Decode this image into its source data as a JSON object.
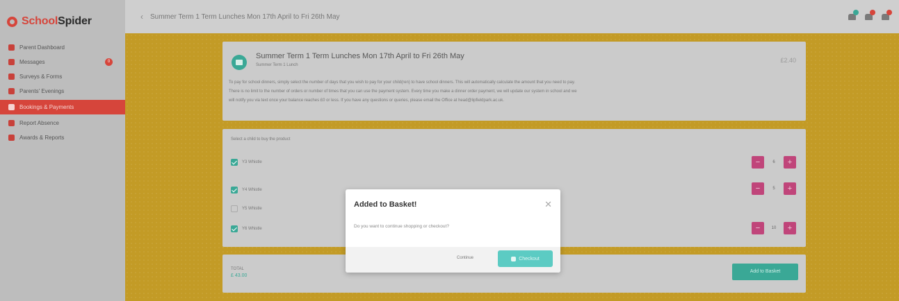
{
  "brand": {
    "logo_text_a": "School",
    "logo_text_b": "Spider"
  },
  "sidebar": {
    "items": [
      {
        "label": "Parent Dashboard",
        "icon": "home-icon"
      },
      {
        "label": "Messages",
        "icon": "mail-icon",
        "badge": "0"
      },
      {
        "label": "Surveys & Forms",
        "icon": "clipboard-icon"
      },
      {
        "label": "Parents' Evenings",
        "icon": "calendar-icon"
      },
      {
        "label": "Bookings & Payments",
        "icon": "basket-icon",
        "active": true
      },
      {
        "label": "Report Absence",
        "icon": "report-icon"
      },
      {
        "label": "Awards & Reports",
        "icon": "trophy-icon"
      }
    ]
  },
  "topbar": {
    "breadcrumb": "Summer Term 1 Term Lunches Mon 17th April to Fri 26th May"
  },
  "colors": {
    "accent_red": "#d6453b",
    "teal": "#3aa896",
    "magenta": "#c0457a",
    "background_yellow": "#c39b26"
  },
  "product": {
    "title": "Summer Term 1 Term Lunches Mon 17th April to Fri 26th May",
    "subtitle": "Summer Term 1 Lunch",
    "price": "£2.40",
    "description_lines": [
      "To pay for school dinners, simply select the number of days that you wish to pay for your child(ren) to have school dinners. This will automatically calculate the amount that you need to pay.",
      "There is no limit to the number of orders or number of times that you can use the payment system. Every time you make a dinner order payment, we will update our system in school and we",
      "will notify you via text once your balance reaches £0 or less. If you have any questions or queries, please email the Office at head@lipfieldpark.ac.uk."
    ]
  },
  "selection": {
    "prompt": "Select a child to buy the product",
    "options": [
      {
        "label": "Y3 Whistle",
        "checked": true,
        "quantity": "6"
      },
      {
        "label": "Y4 Whistle",
        "checked": true,
        "quantity": "5"
      },
      {
        "label": "Y5 Whistle",
        "checked": false
      },
      {
        "label": "Y6 Whistle",
        "checked": true,
        "quantity": "10"
      }
    ]
  },
  "total": {
    "label": "TOTAL",
    "value": "£ 43.00",
    "add_button": "Add to Basket"
  },
  "modal": {
    "title": "Added to Basket!",
    "body": "Do you want to continue shopping or checkout?",
    "continue_label": "Continue",
    "checkout_label": "Checkout"
  }
}
